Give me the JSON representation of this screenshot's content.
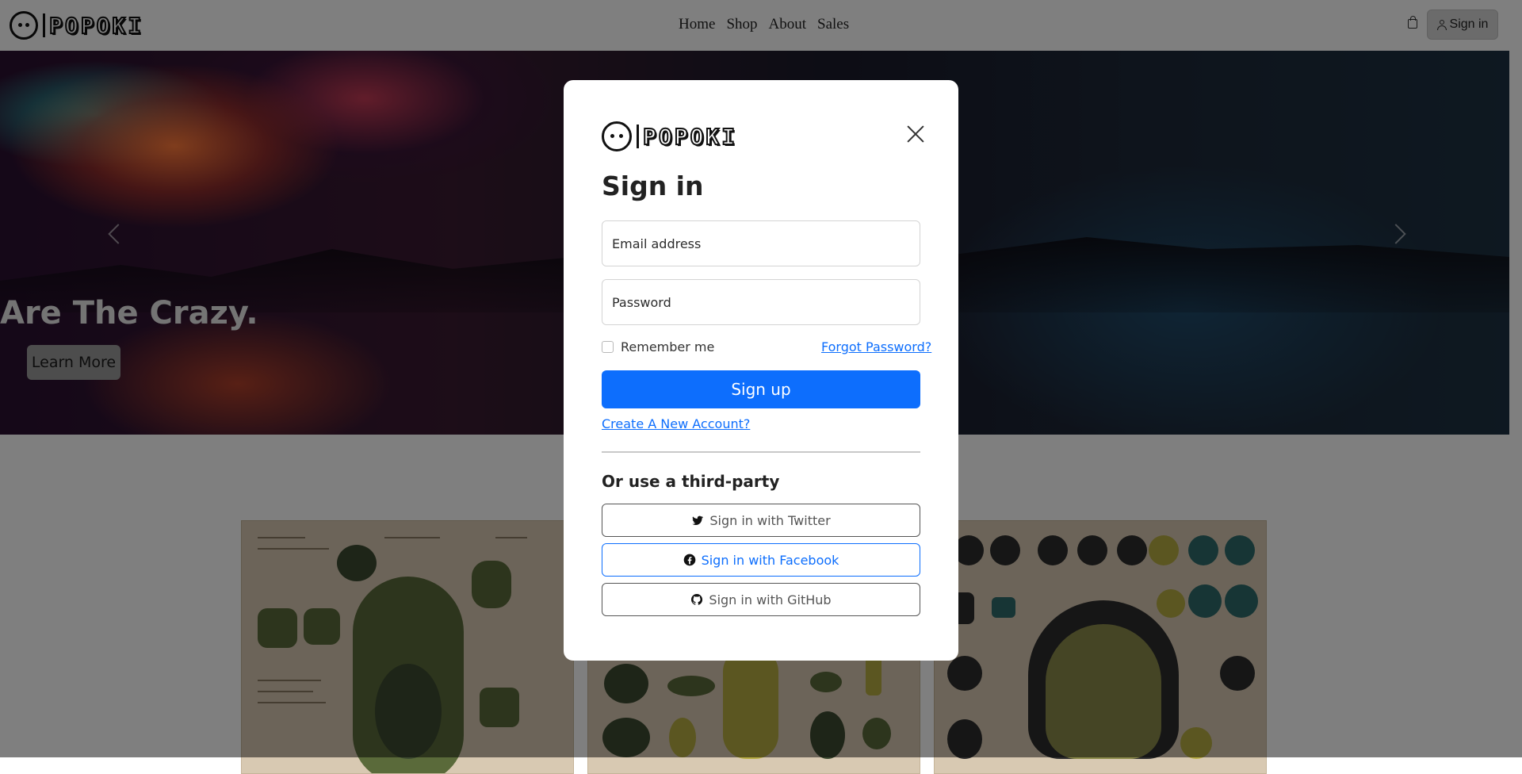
{
  "brand": {
    "name": "POPOKI"
  },
  "nav": {
    "links": [
      "Home",
      "Shop",
      "About",
      "Sales"
    ],
    "signin_label": "Sign in"
  },
  "hero": {
    "caption": "Are The Crazy.",
    "button_label": "Learn More"
  },
  "modal": {
    "title": "Sign in",
    "email_placeholder": "Email address",
    "password_placeholder": "Password",
    "remember_label": "Remember me",
    "forgot_label": "Forgot Password?",
    "submit_label": "Sign up",
    "create_label": "Create A New Account?",
    "third_party_heading": "Or use a third-party",
    "social": {
      "twitter": "Sign in with Twitter",
      "facebook": "Sign in with Facebook",
      "github": "Sign in with GitHub"
    }
  },
  "colors": {
    "primary": "#0d6efd",
    "backdrop": "rgba(0,0,0,0.5)"
  }
}
